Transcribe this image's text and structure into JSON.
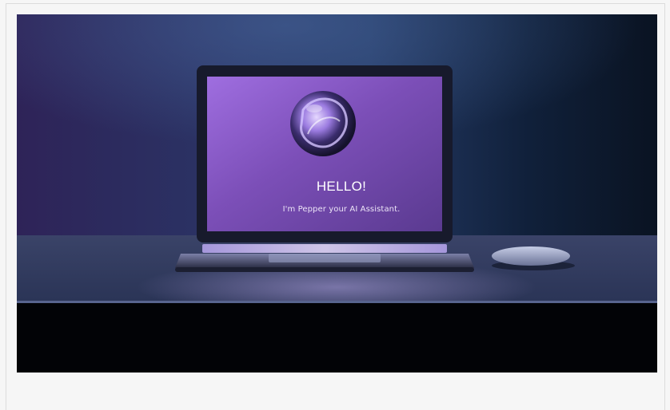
{
  "hero": {
    "greeting": "HELLO!",
    "subtitle": "I'm Pepper your AI Assistant."
  },
  "palette": {
    "background_left": "#2c2356",
    "background_right": "#0b1424",
    "screen_left": "#9a6ad6",
    "screen_right": "#6a3fa0",
    "desk": "#2b3556",
    "floor": "#020306"
  },
  "icons": {
    "assistant_logo": "iridescent-orb"
  }
}
